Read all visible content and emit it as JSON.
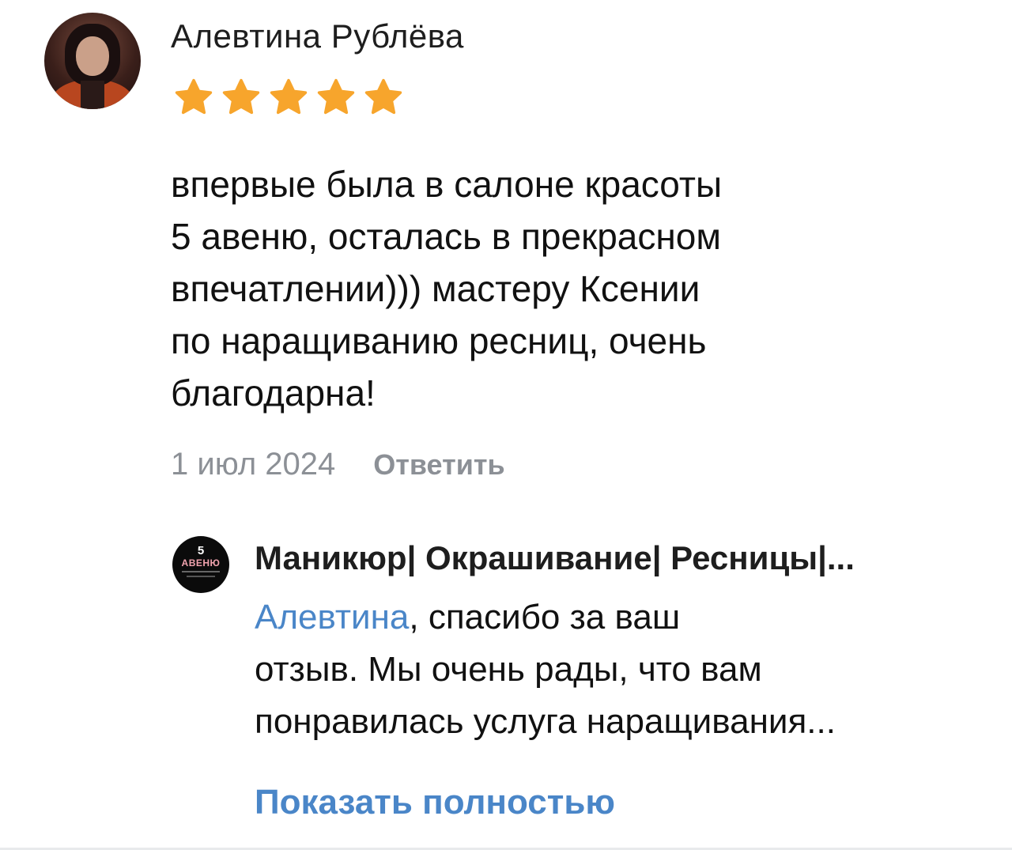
{
  "review": {
    "author": "Алевтина Рублёва",
    "rating": 5,
    "rating_max": 5,
    "star_color": "#f7a52c",
    "text_lines": [
      "впервые была в салоне красоты",
      "5 авеню, осталась в прекрасном",
      "впечатлении))) мастеру Ксении",
      "по наращиванию ресниц, очень",
      "благодарна!"
    ],
    "date": "1 июл 2024",
    "reply_label": "Ответить"
  },
  "org_reply": {
    "avatar_number": "5",
    "avatar_brand": "АВЕНЮ",
    "org_name": "Маникюр| Окрашивание| Ресницы|...",
    "mention": "Алевтина",
    "text_after_mention": ", спасибо за ваш",
    "text_lines": [
      "отзыв. Мы очень рады, что вам",
      "понравилась услуга наращивания..."
    ],
    "show_full_label": "Показать полностью",
    "link_color": "#4a86c8"
  }
}
